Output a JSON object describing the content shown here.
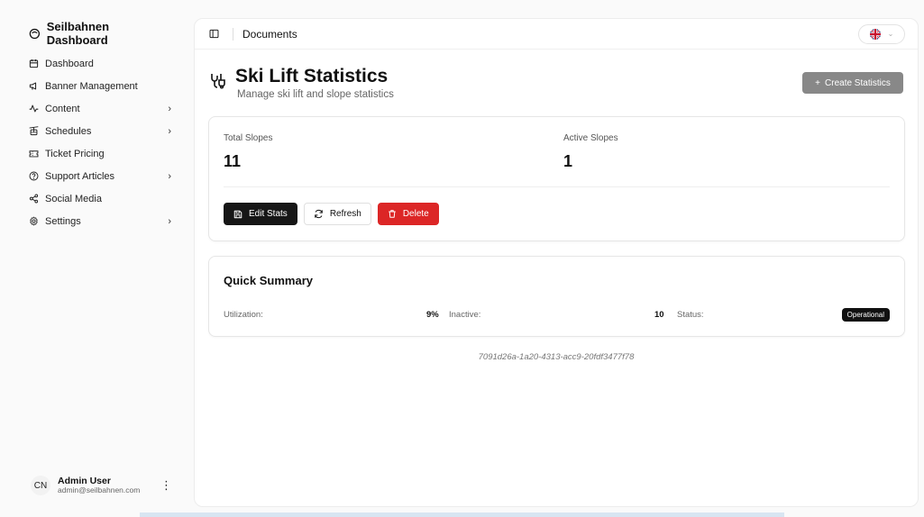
{
  "sidebar": {
    "brand": "Seilbahnen Dashboard",
    "items": [
      {
        "label": "Dashboard",
        "icon": "calendar-icon",
        "has_submenu": false
      },
      {
        "label": "Banner Management",
        "icon": "megaphone-icon",
        "has_submenu": false
      },
      {
        "label": "Content",
        "icon": "activity-icon",
        "has_submenu": true
      },
      {
        "label": "Schedules",
        "icon": "cable-car-icon",
        "has_submenu": true
      },
      {
        "label": "Ticket Pricing",
        "icon": "ticket-icon",
        "has_submenu": false
      },
      {
        "label": "Support Articles",
        "icon": "help-circle-icon",
        "has_submenu": true
      },
      {
        "label": "Social Media",
        "icon": "share-icon",
        "has_submenu": false
      },
      {
        "label": "Settings",
        "icon": "gear-icon",
        "has_submenu": true
      }
    ],
    "user": {
      "initials": "CN",
      "name": "Admin User",
      "email": "admin@seilbahnen.com"
    }
  },
  "topbar": {
    "title": "Documents",
    "language": "en-GB"
  },
  "page": {
    "title": "Ski Lift Statistics",
    "subtitle": "Manage ski lift and slope statistics",
    "create_label": "Create Statistics"
  },
  "stats": {
    "total_label": "Total Slopes",
    "total_value": "11",
    "active_label": "Active Slopes",
    "active_value": "1",
    "edit_label": "Edit Stats",
    "refresh_label": "Refresh",
    "delete_label": "Delete"
  },
  "summary": {
    "title": "Quick Summary",
    "utilization_label": "Utilization:",
    "utilization_value": "9%",
    "inactive_label": "Inactive:",
    "inactive_value": "10",
    "status_label": "Status:",
    "status_value": "Operational"
  },
  "record_id": "7091d26a-1a20-4313-acc9-20fdf3477f78",
  "colors": {
    "accent_dark": "#161616",
    "danger": "#dc2626",
    "muted_button": "#888888"
  }
}
